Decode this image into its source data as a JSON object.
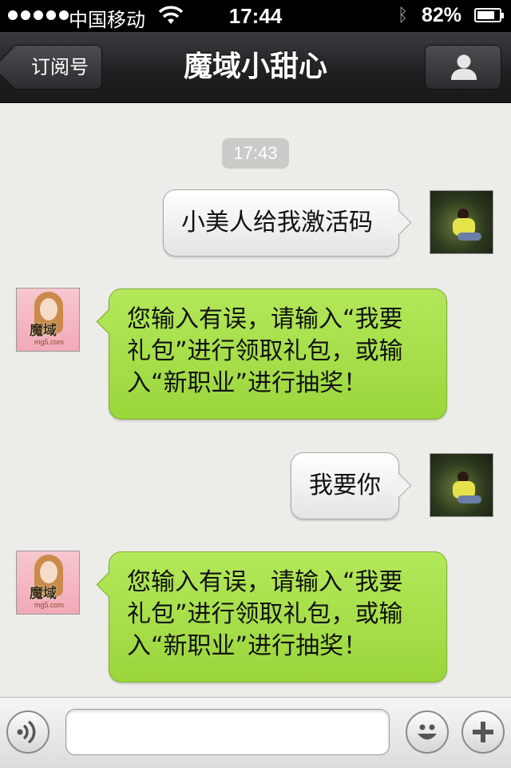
{
  "status_bar": {
    "carrier": "中国移动",
    "time": "17:44",
    "battery_percent": "82%",
    "battery_level": 0.82
  },
  "nav": {
    "back_label": "订阅号",
    "title": "魔域小甜心",
    "profile_icon": "person-icon"
  },
  "chat": {
    "timestamp": "17:43",
    "messages": [
      {
        "direction": "outgoing",
        "text": "小美人给我激活码"
      },
      {
        "direction": "incoming",
        "text": "您输入有误，请输入“我要\n礼包”进行领取礼包，或输\n入“新职业”进行抽奖！"
      },
      {
        "direction": "outgoing",
        "text": "我要你"
      },
      {
        "direction": "incoming",
        "text": "您输入有误，请输入“我要\n礼包”进行领取礼包，或输\n入“新职业”进行抽奖！"
      }
    ],
    "bot_avatar": {
      "logo": "魔域",
      "site": "mg5.com"
    }
  },
  "input_bar": {
    "placeholder": "",
    "voice_icon": "voice-icon",
    "emoji_icon": "smiley-icon",
    "plus_icon": "plus-icon"
  },
  "colors": {
    "incoming_bubble": "#a8e04c",
    "outgoing_bubble": "#f2f2f2",
    "nav_bar": "#1f2123"
  }
}
